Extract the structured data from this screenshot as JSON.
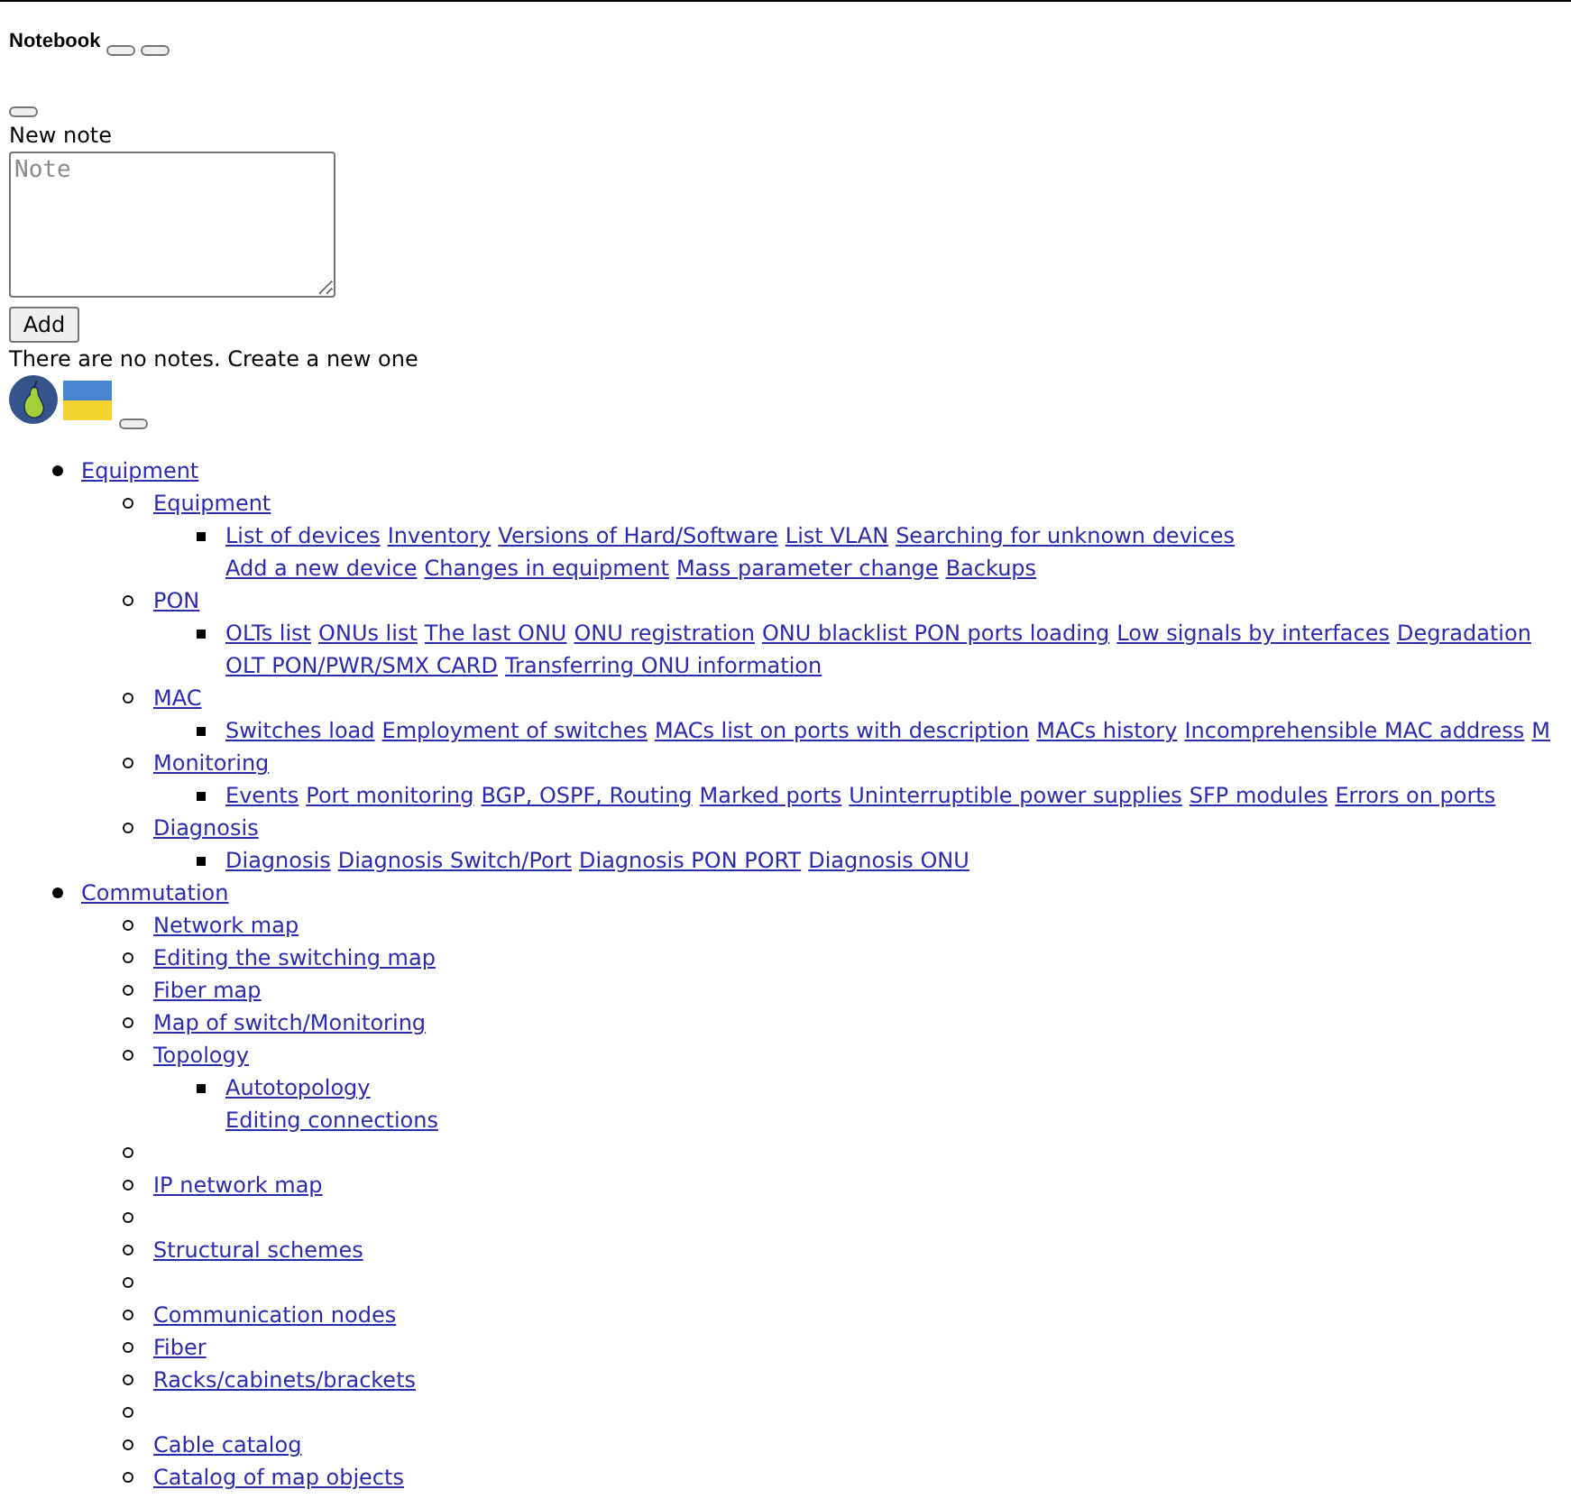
{
  "notebook": {
    "title": "Notebook",
    "new_note_label": "New note",
    "note_field": {
      "placeholder": "Note"
    },
    "add_button": "Add",
    "empty_message": "There are no notes. Create a new one"
  },
  "menu": [
    {
      "label": "Equipment",
      "children": [
        {
          "kind": "link",
          "label": "Equipment",
          "lines": [
            {
              "links": [
                "List of devices",
                "Inventory",
                "Versions of Hard/Software",
                "List VLAN",
                "Searching for unknown devices"
              ]
            },
            {
              "links": [
                "Add a new device",
                "Changes in equipment",
                "Mass parameter change",
                "Backups"
              ]
            }
          ]
        },
        {
          "kind": "link",
          "label": "PON",
          "lines": [
            {
              "links": [
                "OLTs list",
                "ONUs list",
                "The last ONU",
                "ONU registration",
                "ONU blacklist PON ports loading",
                "Low signals by interfaces",
                "Degradation"
              ]
            },
            {
              "links": [
                "OLT PON/PWR/SMX CARD",
                "Transferring ONU information"
              ]
            }
          ]
        },
        {
          "kind": "link",
          "label": "MAC",
          "lines": [
            {
              "links": [
                "Switches load",
                "Employment of switches",
                "MACs list on ports with description",
                "MACs history",
                "Incomprehensible MAC address",
                "M"
              ]
            }
          ]
        },
        {
          "kind": "link",
          "label": "Monitoring",
          "lines": [
            {
              "links": [
                "Events",
                "Port monitoring",
                "BGP, OSPF, Routing",
                "Marked ports",
                "Uninterruptible power supplies",
                "SFP modules",
                "Errors on ports"
              ]
            }
          ]
        },
        {
          "kind": "link",
          "label": "Diagnosis",
          "lines": [
            {
              "links": [
                "Diagnosis",
                "Diagnosis Switch/Port",
                "Diagnosis PON PORT",
                "Diagnosis ONU"
              ]
            }
          ]
        }
      ]
    },
    {
      "label": "Commutation",
      "children": [
        {
          "kind": "link",
          "label": "Network map"
        },
        {
          "kind": "link",
          "label": "Editing the switching map"
        },
        {
          "kind": "link",
          "label": "Fiber map"
        },
        {
          "kind": "link",
          "label": "Map of switch/Monitoring"
        },
        {
          "kind": "link",
          "label": "Topology",
          "lines": [
            {
              "links": [
                "Autotopology"
              ]
            },
            {
              "links": [
                "Editing connections"
              ]
            }
          ]
        },
        {
          "kind": "empty"
        },
        {
          "kind": "link",
          "label": "IP network map"
        },
        {
          "kind": "empty"
        },
        {
          "kind": "link",
          "label": "Structural schemes"
        },
        {
          "kind": "empty"
        },
        {
          "kind": "link",
          "label": "Communication nodes"
        },
        {
          "kind": "link",
          "label": "Fiber"
        },
        {
          "kind": "link",
          "label": "Racks/cabinets/brackets"
        },
        {
          "kind": "empty"
        },
        {
          "kind": "link",
          "label": "Cable catalog"
        },
        {
          "kind": "link",
          "label": "Catalog of map objects"
        }
      ]
    }
  ]
}
